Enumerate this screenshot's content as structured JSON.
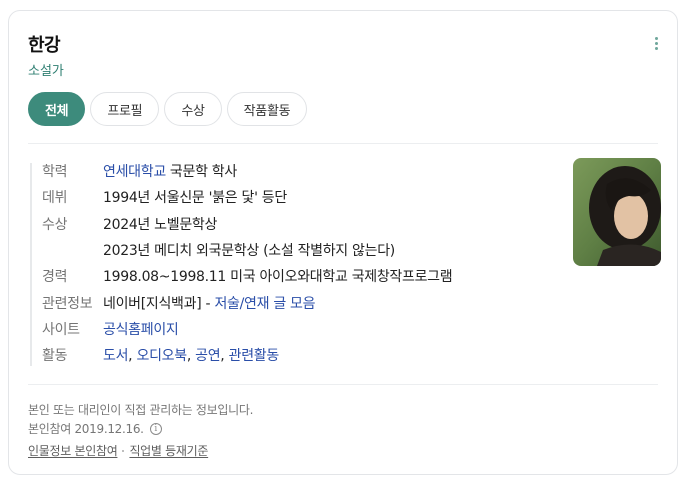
{
  "profile": {
    "name": "한강",
    "occupation": "소설가",
    "photo_icon": "profile-photo"
  },
  "tabs": [
    {
      "label": "전체",
      "active": true
    },
    {
      "label": "프로필",
      "active": false
    },
    {
      "label": "수상",
      "active": false
    },
    {
      "label": "작품활동",
      "active": false
    }
  ],
  "info": {
    "education": {
      "label": "학력",
      "link": "연세대학교",
      "rest": "국문학 학사"
    },
    "debut": {
      "label": "데뷔",
      "value": "1994년 서울신문 '붉은 닻' 등단"
    },
    "awards": {
      "label": "수상",
      "values": [
        "2024년 노벨문학상",
        "2023년 메디치 외국문학상 (소설 작별하지 않는다)"
      ]
    },
    "career": {
      "label": "경력",
      "value": "1998.08~1998.11 미국 아이오와대학교 국제창작프로그램"
    },
    "related": {
      "label": "관련정보",
      "prefix": "네이버[지식백과] - ",
      "link": "저술/연재 글 모음"
    },
    "site": {
      "label": "사이트",
      "link": "공식홈페이지"
    },
    "activity": {
      "label": "활동",
      "links": [
        "도서",
        "오디오북",
        "공연",
        "관련활동"
      ],
      "separator": ","
    }
  },
  "footer": {
    "note": "본인 또는 대리인이 직접 관리하는 정보입니다.",
    "verified": "본인참여 2019.12.16.",
    "info_icon_glyph": "i",
    "links": [
      "인물정보 본인참여",
      "직업별 등재기준"
    ]
  },
  "colors": {
    "accent": "#3d8b7c",
    "link": "#2a4ea8"
  }
}
